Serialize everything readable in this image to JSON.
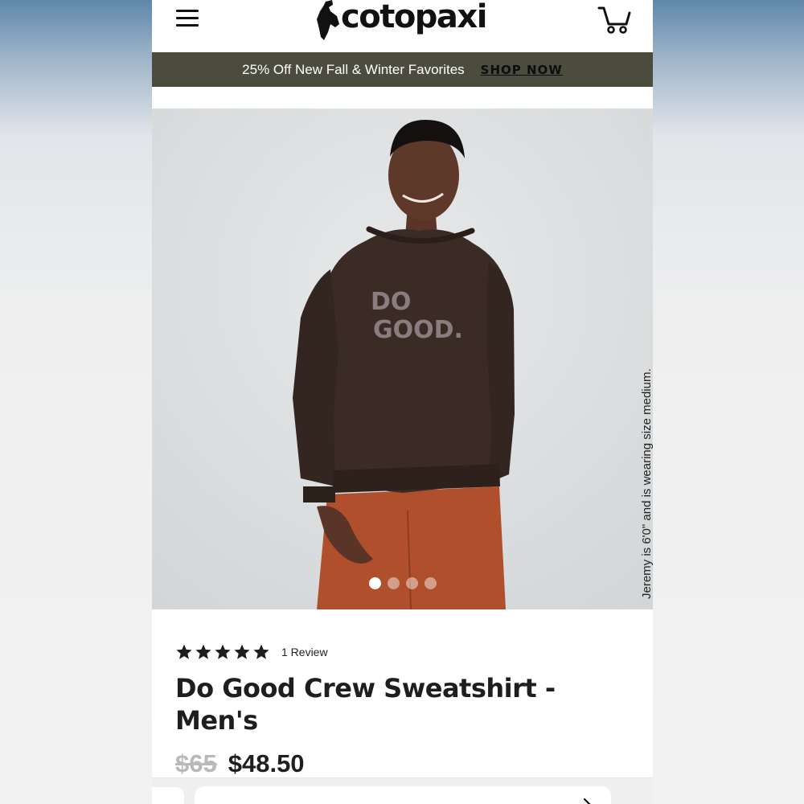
{
  "header": {
    "brand": "cotopaxi",
    "menu_icon": "hamburger-menu-icon",
    "cart_icon": "shopping-cart-icon"
  },
  "promo": {
    "text": "25% Off New Fall & Winter Favorites",
    "link_label": "SHOP NOW",
    "background": "#4c4c3e"
  },
  "hero": {
    "alt": "Model wearing brown Do Good crew sweatshirt with rust-colored pants",
    "shirt_graphic": [
      "DO",
      "GOOD."
    ],
    "caption": "Jeremy is 6'0\" and is wearing size medium.",
    "carousel_count": 4,
    "carousel_active": 1
  },
  "product": {
    "rating": 5,
    "rating_max": 5,
    "review_label": "1 Review",
    "title_line1": "Do Good Crew Sweatshirt -",
    "title_line2": "Men's",
    "original_price": "$65",
    "sale_price": "$48.50"
  },
  "colors": {
    "sweatshirt": "#3a2b25",
    "pants": "#b04f2b",
    "star": "#1e1e1e"
  }
}
